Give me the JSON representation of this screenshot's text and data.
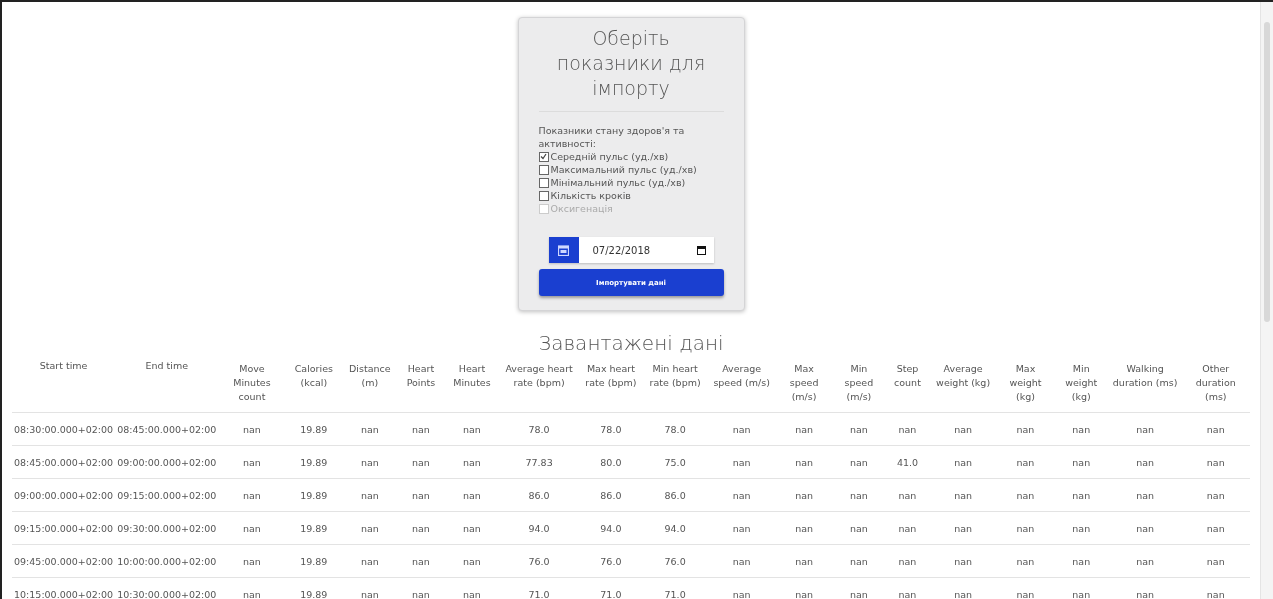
{
  "import_card": {
    "title": "Оберіть показники для імпорту",
    "group_label": "Показники стану здоров'я та активності:",
    "options": [
      {
        "label": "Середній пульс (уд./хв)",
        "checked": true,
        "disabled": false
      },
      {
        "label": "Максимальний пульс (уд./хв)",
        "checked": false,
        "disabled": false
      },
      {
        "label": "Мінімальний пульс (уд./хв)",
        "checked": false,
        "disabled": false
      },
      {
        "label": "Кількість кроків",
        "checked": false,
        "disabled": false
      },
      {
        "label": "Оксигенація",
        "checked": false,
        "disabled": true
      }
    ],
    "date": {
      "value": "07/22/2018"
    },
    "button": "Імпортувати дані"
  },
  "data_section": {
    "title": "Завантажені дані",
    "table": {
      "columns": [
        "Start time",
        "End time",
        "Move Minutes count",
        "Calories (kcal)",
        "Distance (m)",
        "Heart Points",
        "Heart Minutes",
        "Average heart rate (bpm)",
        "Max heart rate (bpm)",
        "Min heart rate (bpm)",
        "Average speed (m/s)",
        "Max speed (m/s)",
        "Min speed (m/s)",
        "Step count",
        "Average weight (kg)",
        "Max weight (kg)",
        "Min weight (kg)",
        "Walking duration (ms)",
        "Other duration (ms)"
      ],
      "rows": [
        [
          "08:30:00.000+02:00",
          "08:45:00.000+02:00",
          "nan",
          "19.89",
          "nan",
          "nan",
          "nan",
          "78.0",
          "78.0",
          "78.0",
          "nan",
          "nan",
          "nan",
          "nan",
          "nan",
          "nan",
          "nan",
          "nan",
          "nan"
        ],
        [
          "08:45:00.000+02:00",
          "09:00:00.000+02:00",
          "nan",
          "19.89",
          "nan",
          "nan",
          "nan",
          "77.83",
          "80.0",
          "75.0",
          "nan",
          "nan",
          "nan",
          "41.0",
          "nan",
          "nan",
          "nan",
          "nan",
          "nan"
        ],
        [
          "09:00:00.000+02:00",
          "09:15:00.000+02:00",
          "nan",
          "19.89",
          "nan",
          "nan",
          "nan",
          "86.0",
          "86.0",
          "86.0",
          "nan",
          "nan",
          "nan",
          "nan",
          "nan",
          "nan",
          "nan",
          "nan",
          "nan"
        ],
        [
          "09:15:00.000+02:00",
          "09:30:00.000+02:00",
          "nan",
          "19.89",
          "nan",
          "nan",
          "nan",
          "94.0",
          "94.0",
          "94.0",
          "nan",
          "nan",
          "nan",
          "nan",
          "nan",
          "nan",
          "nan",
          "nan",
          "nan"
        ],
        [
          "09:45:00.000+02:00",
          "10:00:00.000+02:00",
          "nan",
          "19.89",
          "nan",
          "nan",
          "nan",
          "76.0",
          "76.0",
          "76.0",
          "nan",
          "nan",
          "nan",
          "nan",
          "nan",
          "nan",
          "nan",
          "nan",
          "nan"
        ],
        [
          "10:15:00.000+02:00",
          "10:30:00.000+02:00",
          "nan",
          "19.89",
          "nan",
          "nan",
          "nan",
          "71.0",
          "71.0",
          "71.0",
          "nan",
          "nan",
          "nan",
          "nan",
          "nan",
          "nan",
          "nan",
          "nan",
          "nan"
        ]
      ]
    }
  }
}
